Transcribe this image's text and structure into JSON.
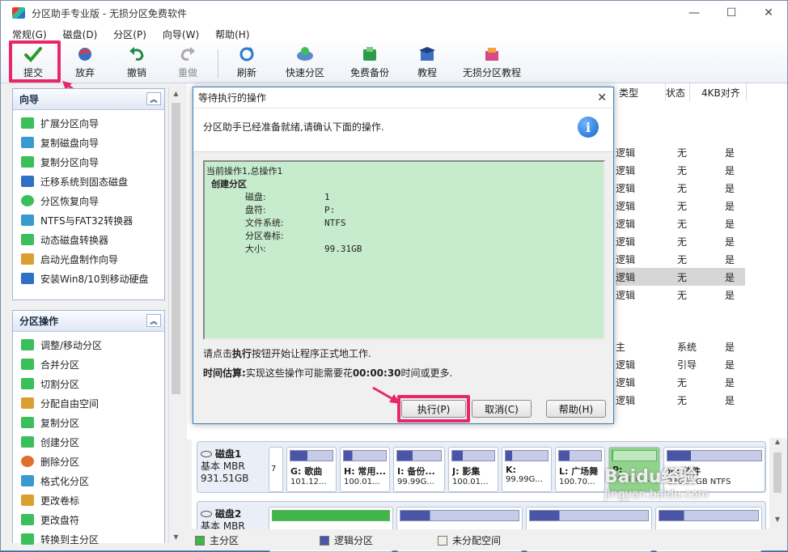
{
  "window": {
    "title": "分区助手专业版 - 无损分区免费软件",
    "controls": [
      "—",
      "☐",
      "✕"
    ]
  },
  "menu": [
    "常规(G)",
    "磁盘(D)",
    "分区(P)",
    "向导(W)",
    "帮助(H)"
  ],
  "toolbar": {
    "commit": "提交",
    "discard": "放弃",
    "undo": "撤销",
    "redo": "重做",
    "refresh": "刷新",
    "quick_partition": "快速分区",
    "free_backup": "免费备份",
    "tutorial": "教程",
    "lossless_tutorial": "无损分区教程"
  },
  "wizard_panel": {
    "title": "向导",
    "items": [
      "扩展分区向导",
      "复制磁盘向导",
      "复制分区向导",
      "迁移系统到固态磁盘",
      "分区恢复向导",
      "NTFS与FAT32转换器",
      "动态磁盘转换器",
      "启动光盘制作向导",
      "安装Win8/10到移动硬盘"
    ]
  },
  "ops_panel": {
    "title": "分区操作",
    "items": [
      "调整/移动分区",
      "合并分区",
      "切割分区",
      "分配自由空间",
      "复制分区",
      "创建分区",
      "删除分区",
      "格式化分区",
      "更改卷标",
      "更改盘符",
      "转换到主分区"
    ]
  },
  "table": {
    "headers": {
      "type": "类型",
      "status": "状态",
      "align": "4KB对齐"
    },
    "rows": [
      {
        "type": "逻辑",
        "status": "无",
        "align": "是"
      },
      {
        "type": "逻辑",
        "status": "无",
        "align": "是"
      },
      {
        "type": "逻辑",
        "status": "无",
        "align": "是"
      },
      {
        "type": "逻辑",
        "status": "无",
        "align": "是"
      },
      {
        "type": "逻辑",
        "status": "无",
        "align": "是"
      },
      {
        "type": "逻辑",
        "status": "无",
        "align": "是"
      },
      {
        "type": "逻辑",
        "status": "无",
        "align": "是"
      },
      {
        "type": "逻辑",
        "status": "无",
        "align": "是"
      },
      {
        "type": "逻辑",
        "status": "无",
        "align": "是"
      },
      {
        "type": "主",
        "status": "系统",
        "align": "是"
      },
      {
        "type": "逻辑",
        "status": "引导",
        "align": "是"
      },
      {
        "type": "逻辑",
        "status": "无",
        "align": "是"
      },
      {
        "type": "逻辑",
        "status": "无",
        "align": "是"
      }
    ]
  },
  "dialog": {
    "title": "等待执行的操作",
    "close": "✕",
    "message": "分区助手已经准备就绪,请确认下面的操作.",
    "info_icon": "i",
    "op_header": "当前操作1,总操作1",
    "op_name": "创建分区",
    "op_fields": [
      {
        "key": "磁盘:",
        "value": "1"
      },
      {
        "key": "盘符:",
        "value": "P:"
      },
      {
        "key": "文件系统:",
        "value": "NTFS"
      },
      {
        "key": "分区卷标:",
        "value": ""
      },
      {
        "key": "大小:",
        "value": "99.31GB"
      }
    ],
    "hint_prefix": "请点击",
    "hint_bold": "执行",
    "hint_suffix": "按钮开始让程序正式地工作.",
    "estimate_label": "时间估算:",
    "estimate_prefix": "实现这些操作可能需要花",
    "estimate_time": "00:00:30",
    "estimate_suffix": "时间或更多.",
    "execute": "执行(P)",
    "cancel": "取消(C)",
    "help": "帮助(H)"
  },
  "disks": [
    {
      "name": "磁盘1",
      "type": "基本 MBR",
      "size": "931.51GB",
      "partitions": [
        {
          "name": "",
          "size": "7",
          "fill": 0
        },
        {
          "name": "G: 歌曲",
          "size": "101.12...",
          "fill": 40
        },
        {
          "name": "H: 常用...",
          "size": "100.01...",
          "fill": 20
        },
        {
          "name": "I: 备份...",
          "size": "99.99G...",
          "fill": 35
        },
        {
          "name": "J: 影集",
          "size": "100.01...",
          "fill": 25
        },
        {
          "name": "K:",
          "size": "99.99G...",
          "fill": 15
        },
        {
          "name": "L: 广场舞",
          "size": "100.70...",
          "fill": 25
        },
        {
          "name": "P:",
          "size": "99.31G...",
          "fill": 2
        },
        {
          "name": "M: 软件",
          "size": "230.37GB NTFS",
          "fill": 25
        }
      ]
    },
    {
      "name": "磁盘2",
      "type": "基本 MBR",
      "size": "",
      "partitions": [
        {
          "name": "",
          "size": "",
          "fill": 100
        },
        {
          "name": "",
          "size": "",
          "fill": 25
        },
        {
          "name": "",
          "size": "",
          "fill": 25
        },
        {
          "name": "",
          "size": "",
          "fill": 25
        }
      ]
    }
  ],
  "legend": {
    "primary": "主分区",
    "logical": "逻辑分区",
    "unallocated": "未分配空间"
  },
  "colors": {
    "highlight": "#e8276a",
    "oplist_bg": "#c7ebcd",
    "primary": "#3fb54a",
    "logical": "#4a55a8",
    "selected_part": "#8fd48a"
  },
  "watermark": "Baidu经验 jingyan.baidu.com"
}
